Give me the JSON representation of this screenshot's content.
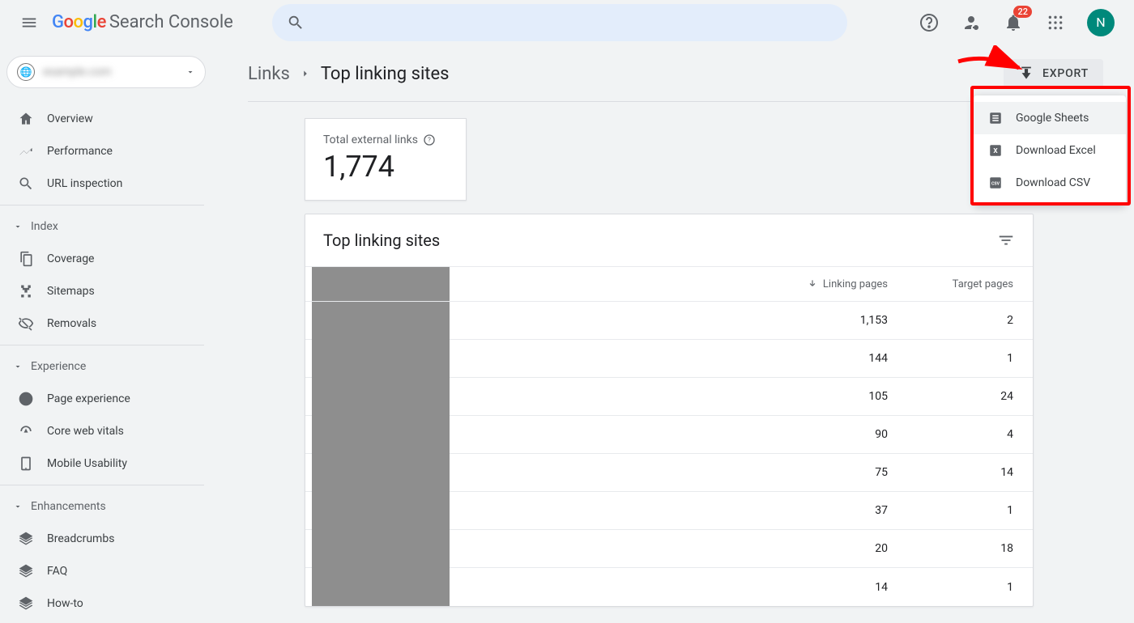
{
  "header": {
    "product_name": "Search Console",
    "notification_count": "22",
    "avatar_initial": "N"
  },
  "sidebar": {
    "property_label": "example.com",
    "items": [
      {
        "icon": "home",
        "label": "Overview"
      },
      {
        "icon": "trend",
        "label": "Performance"
      },
      {
        "icon": "search",
        "label": "URL inspection"
      }
    ],
    "sections": [
      {
        "title": "Index",
        "items": [
          {
            "icon": "copy",
            "label": "Coverage"
          },
          {
            "icon": "sitemap",
            "label": "Sitemaps"
          },
          {
            "icon": "visibility-off",
            "label": "Removals"
          }
        ]
      },
      {
        "title": "Experience",
        "items": [
          {
            "icon": "circle-plus",
            "label": "Page experience"
          },
          {
            "icon": "gauge",
            "label": "Core web vitals"
          },
          {
            "icon": "mobile",
            "label": "Mobile Usability"
          }
        ]
      },
      {
        "title": "Enhancements",
        "items": [
          {
            "icon": "layers",
            "label": "Breadcrumbs"
          },
          {
            "icon": "layers",
            "label": "FAQ"
          },
          {
            "icon": "layers",
            "label": "How-to"
          }
        ]
      }
    ]
  },
  "breadcrumb": {
    "parent": "Links",
    "current": "Top linking sites",
    "export_label": "EXPORT"
  },
  "kpi": {
    "label": "Total external links",
    "value": "1,774"
  },
  "table": {
    "title": "Top linking sites",
    "columns": {
      "a": "Linking pages",
      "b": "Target pages"
    },
    "rows": [
      {
        "linking_pages": "1,153",
        "target_pages": "2"
      },
      {
        "linking_pages": "144",
        "target_pages": "1"
      },
      {
        "linking_pages": "105",
        "target_pages": "24"
      },
      {
        "linking_pages": "90",
        "target_pages": "4"
      },
      {
        "linking_pages": "75",
        "target_pages": "14"
      },
      {
        "linking_pages": "37",
        "target_pages": "1"
      },
      {
        "linking_pages": "20",
        "target_pages": "18"
      },
      {
        "linking_pages": "14",
        "target_pages": "1"
      }
    ]
  },
  "export_menu": {
    "items": [
      {
        "icon": "sheets",
        "label": "Google Sheets"
      },
      {
        "icon": "excel",
        "label": "Download Excel"
      },
      {
        "icon": "csv",
        "label": "Download CSV"
      }
    ]
  }
}
